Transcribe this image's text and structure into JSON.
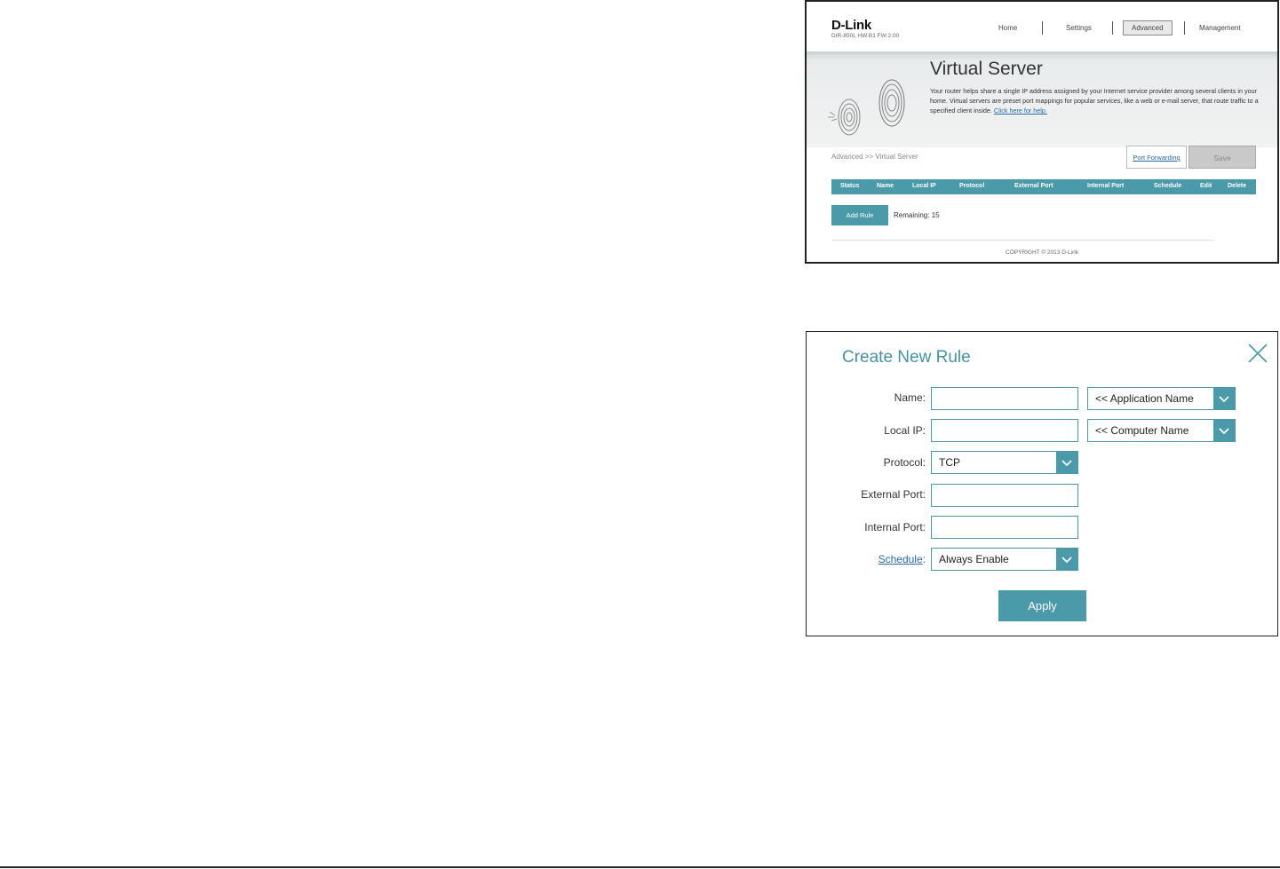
{
  "router": {
    "brand": "D-Link",
    "model_line": "DIR-850L   HW:B1   FW:2.00",
    "nav": [
      {
        "label": "Home",
        "active": false
      },
      {
        "label": "Settings",
        "active": false
      },
      {
        "label": "Advanced",
        "active": true
      },
      {
        "label": "Management",
        "active": false
      }
    ],
    "page_title": "Virtual Server",
    "description": "Your router helps share a single IP address assigned by your Internet service provider among several clients in your home. Virtual servers are preset port mappings for popular services, like a web or e-mail server, that route traffic to a specified client inside.",
    "help_link": "Click here for help.",
    "breadcrumb": "Advanced >> Virtual Server",
    "port_forwarding_label": "Port Forwarding",
    "save_label": "Save",
    "table_headers": [
      "Status",
      "Name",
      "Local IP",
      "Protocol",
      "External Port",
      "Internal Port",
      "Schedule",
      "Edit",
      "Delete"
    ],
    "add_rule_label": "Add Rule",
    "remaining": "Remaining: 15",
    "copyright": "COPYRIGHT © 2013 D-Link"
  },
  "dialog": {
    "title": "Create New Rule",
    "labels": {
      "name": "Name:",
      "local_ip": "Local IP:",
      "protocol": "Protocol:",
      "external_port": "External Port:",
      "internal_port": "Internal Port:",
      "schedule": "Schedule",
      "schedule_colon": ":"
    },
    "values": {
      "name": "",
      "local_ip": "",
      "external_port": "",
      "internal_port": ""
    },
    "application_name": "<< Application Name",
    "computer_name": "<< Computer Name",
    "protocol": "TCP",
    "schedule": "Always Enable",
    "apply_label": "Apply"
  },
  "colors": {
    "accent": "#4a9aaa",
    "title": "#4592a6",
    "link": "#2a6aa8"
  }
}
